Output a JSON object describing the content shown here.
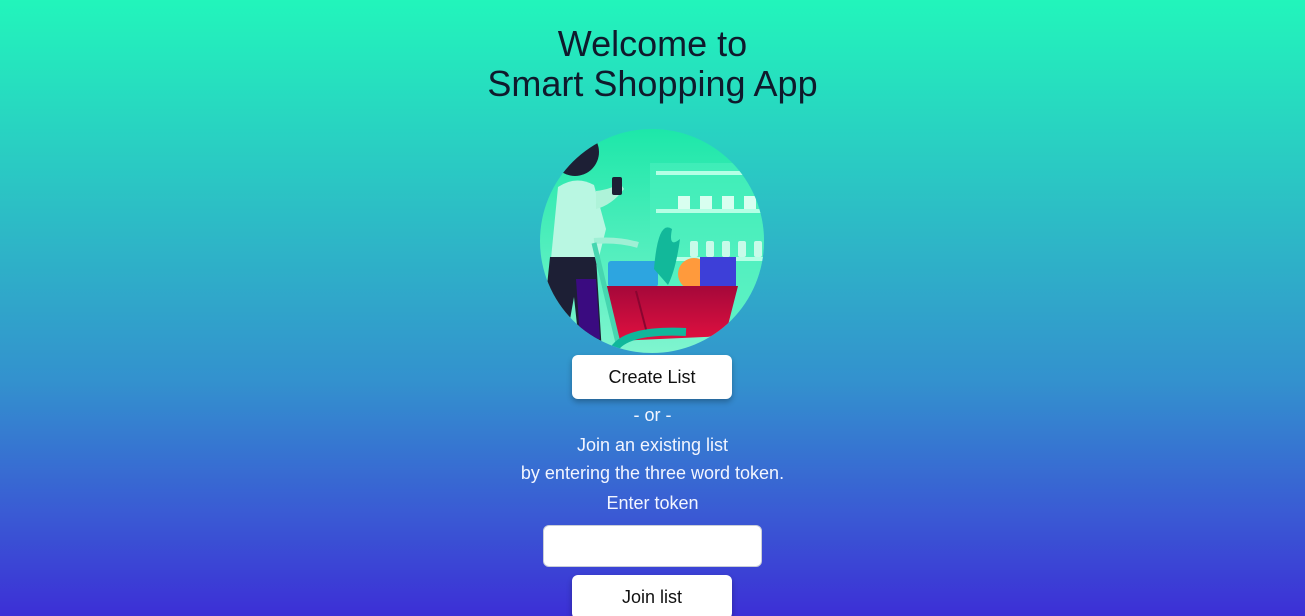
{
  "header": {
    "title_line1": "Welcome to",
    "title_line2": "Smart Shopping App"
  },
  "hero": {
    "icon": "shopper-with-cart-illustration"
  },
  "actions": {
    "create_label": "Create List",
    "or_text": "- or -",
    "join_line1": "Join an existing list",
    "join_line2": "by entering the three word token.",
    "token_label": "Enter token",
    "token_value": "",
    "token_placeholder": "",
    "join_label": "Join list"
  },
  "colors": {
    "gradient_top": "#22f5bb",
    "gradient_bottom": "#3c2fd6",
    "title_text": "#0f1a2c",
    "button_bg": "#ffffff"
  }
}
